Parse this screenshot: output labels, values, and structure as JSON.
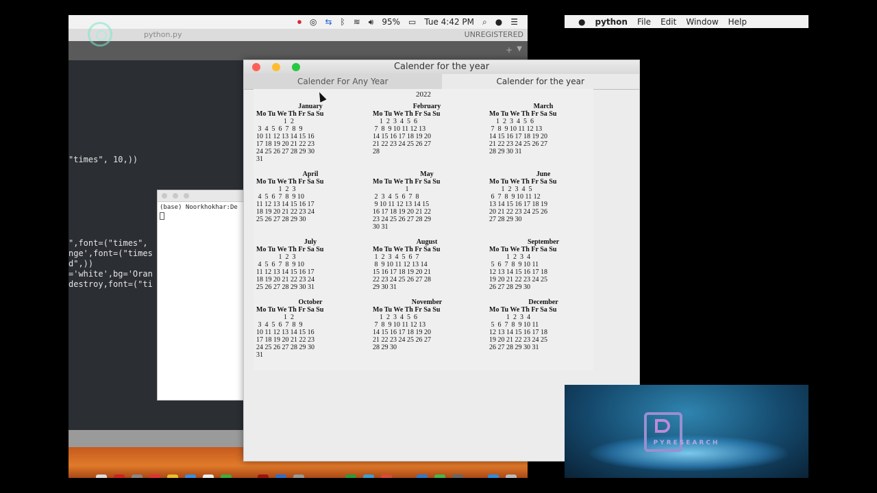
{
  "menubar_left": {
    "battery": "95%",
    "clock": "Tue 4:42 PM"
  },
  "editor": {
    "filename": "python.py",
    "unregistered": "UNREGISTERED",
    "code_lines": [
      "\"times\", 10,))",
      "\",font=(\"times\",",
      "nge',font=(\"times",
      "d\",))",
      "='white',bg='Oran",
      "destroy,font=(\"ti"
    ]
  },
  "terminal": {
    "prompt": "(base) Noorkhokhar:De"
  },
  "calendar_window": {
    "title": "Calender for the year",
    "tabs": [
      "Calender For Any Year",
      "Calender for the year"
    ],
    "year": "2022",
    "day_header": "Mo Tu We Th Fr Sa Su",
    "months": [
      {
        "name": "January",
        "rows": [
          "                1  2",
          " 3  4  5  6  7  8  9",
          "10 11 12 13 14 15 16",
          "17 18 19 20 21 22 23",
          "24 25 26 27 28 29 30",
          "31"
        ]
      },
      {
        "name": "February",
        "rows": [
          "    1  2  3  4  5  6",
          " 7  8  9 10 11 12 13",
          "14 15 16 17 18 19 20",
          "21 22 23 24 25 26 27",
          "28"
        ]
      },
      {
        "name": "March",
        "rows": [
          "    1  2  3  4  5  6",
          " 7  8  9 10 11 12 13",
          "14 15 16 17 18 19 20",
          "21 22 23 24 25 26 27",
          "28 29 30 31"
        ]
      },
      {
        "name": "April",
        "rows": [
          "             1  2  3",
          " 4  5  6  7  8  9 10",
          "11 12 13 14 15 16 17",
          "18 19 20 21 22 23 24",
          "25 26 27 28 29 30"
        ]
      },
      {
        "name": "May",
        "rows": [
          "                   1",
          " 2  3  4  5  6  7  8",
          " 9 10 11 12 13 14 15",
          "16 17 18 19 20 21 22",
          "23 24 25 26 27 28 29",
          "30 31"
        ]
      },
      {
        "name": "June",
        "rows": [
          "       1  2  3  4  5",
          " 6  7  8  9 10 11 12",
          "13 14 15 16 17 18 19",
          "20 21 22 23 24 25 26",
          "27 28 29 30"
        ]
      },
      {
        "name": "July",
        "rows": [
          "             1  2  3",
          " 4  5  6  7  8  9 10",
          "11 12 13 14 15 16 17",
          "18 19 20 21 22 23 24",
          "25 26 27 28 29 30 31"
        ]
      },
      {
        "name": "August",
        "rows": [
          " 1  2  3  4  5  6  7",
          " 8  9 10 11 12 13 14",
          "15 16 17 18 19 20 21",
          "22 23 24 25 26 27 28",
          "29 30 31"
        ]
      },
      {
        "name": "September",
        "rows": [
          "          1  2  3  4",
          " 5  6  7  8  9 10 11",
          "12 13 14 15 16 17 18",
          "19 20 21 22 23 24 25",
          "26 27 28 29 30"
        ]
      },
      {
        "name": "October",
        "rows": [
          "                1  2",
          " 3  4  5  6  7  8  9",
          "10 11 12 13 14 15 16",
          "17 18 19 20 21 22 23",
          "24 25 26 27 28 29 30",
          "31"
        ]
      },
      {
        "name": "November",
        "rows": [
          "    1  2  3  4  5  6",
          " 7  8  9 10 11 12 13",
          "14 15 16 17 18 19 20",
          "21 22 23 24 25 26 27",
          "28 29 30"
        ]
      },
      {
        "name": "December",
        "rows": [
          "          1  2  3  4",
          " 5  6  7  8  9 10 11",
          "12 13 14 15 16 17 18",
          "19 20 21 22 23 24 25",
          "26 27 28 29 30 31"
        ]
      }
    ]
  },
  "menubar_right": {
    "items": [
      "python",
      "File",
      "Edit",
      "Window",
      "Help"
    ]
  },
  "logo": {
    "text": "PYRESEARCH"
  },
  "colors": {
    "close": "#ff5f57",
    "minimize": "#febc2e",
    "maximize": "#28c840"
  }
}
